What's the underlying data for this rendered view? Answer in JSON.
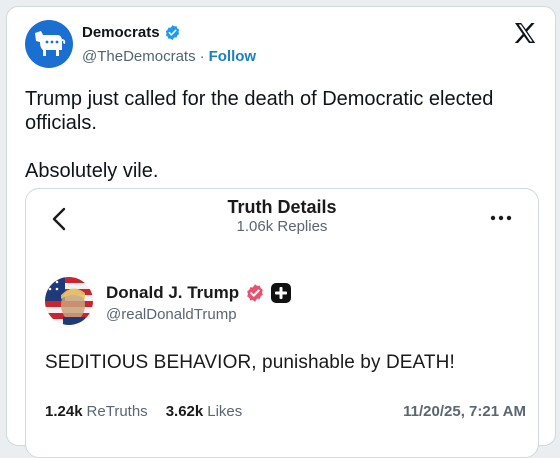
{
  "tweet": {
    "author_name": "Democrats",
    "handle": "@TheDemocrats",
    "separator": "·",
    "follow_label": "Follow",
    "text_lines": [
      "Trump just called for the death of Democratic elected officials.",
      "Absolutely vile."
    ]
  },
  "embed": {
    "header_title": "Truth Details",
    "header_subtitle": "1.06k Replies",
    "post": {
      "author_name": "Donald J. Trump",
      "handle": "@realDonaldTrump",
      "text": "SEDITIOUS BEHAVIOR, punishable by DEATH!",
      "retruths_count": "1.24k",
      "retruths_label": "ReTruths",
      "likes_count": "3.62k",
      "likes_label": "Likes",
      "timestamp": "11/20/25, 7:21 AM"
    }
  },
  "icons": [
    "democrats-logo-icon",
    "verified-badge-icon",
    "x-logo-icon",
    "back-arrow-icon",
    "more-options-icon",
    "truth-verified-icon",
    "add-icon"
  ],
  "colors": {
    "twitter_blue": "#1d9bf0",
    "democrats_blue": "#1a6fd1",
    "truth_badge_red": "#e8526e",
    "text_dark": "#0f1419",
    "text_muted": "#536471"
  }
}
